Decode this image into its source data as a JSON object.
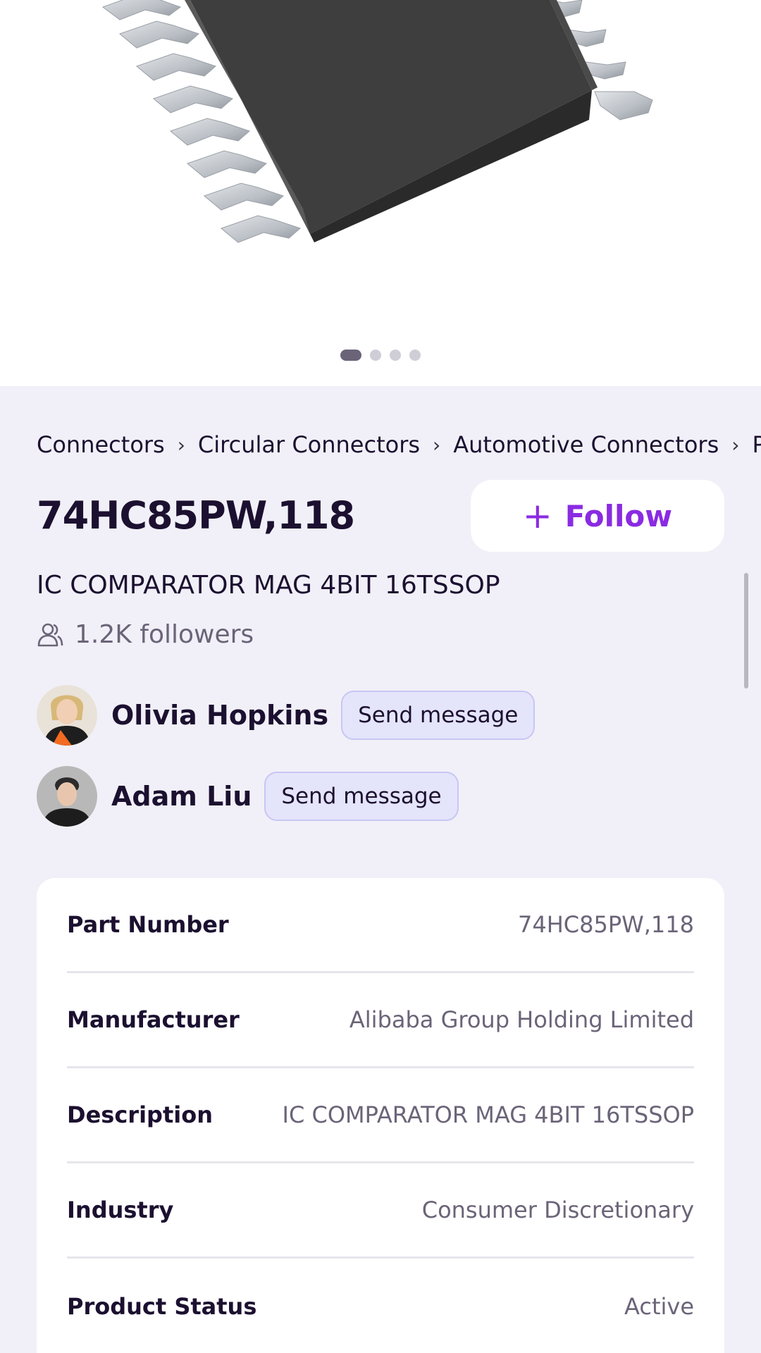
{
  "carousel": {
    "image_name": "chip-image",
    "slide_count": 4,
    "active_slide": 1,
    "dot_active_color": "#6b6478",
    "dot_inactive_color": "#cfcdd6"
  },
  "breadcrumb": [
    "Connectors",
    "Circular Connectors",
    "Automotive Connectors",
    "Pow"
  ],
  "product": {
    "part_number": "74HC85PW,118",
    "description": "IC COMPARATOR MAG 4BIT 16TSSOP",
    "followers_text": "1.2K followers",
    "follow_label": "Follow"
  },
  "contacts": [
    {
      "name": "Olivia Hopkins",
      "button_label": "Send message"
    },
    {
      "name": "Adam Liu",
      "button_label": "Send message"
    }
  ],
  "details": [
    {
      "label": "Part Number",
      "value": "74HC85PW,118"
    },
    {
      "label": "Manufacturer",
      "value": "Alibaba Group Holding Limited"
    },
    {
      "label": "Description",
      "value": "IC COMPARATOR MAG 4BIT 16TSSOP"
    },
    {
      "label": "Industry",
      "value": "Consumer Discretionary"
    },
    {
      "label": "Product Status",
      "value": "Active"
    }
  ],
  "colors": {
    "accent": "#8a2be2",
    "background": "#f1f0f8",
    "message_button_bg": "#e4e4fb"
  },
  "icons": {
    "follow": "plus-icon",
    "followers": "users-icon",
    "breadcrumb_separator": "chevron-right-icon"
  }
}
